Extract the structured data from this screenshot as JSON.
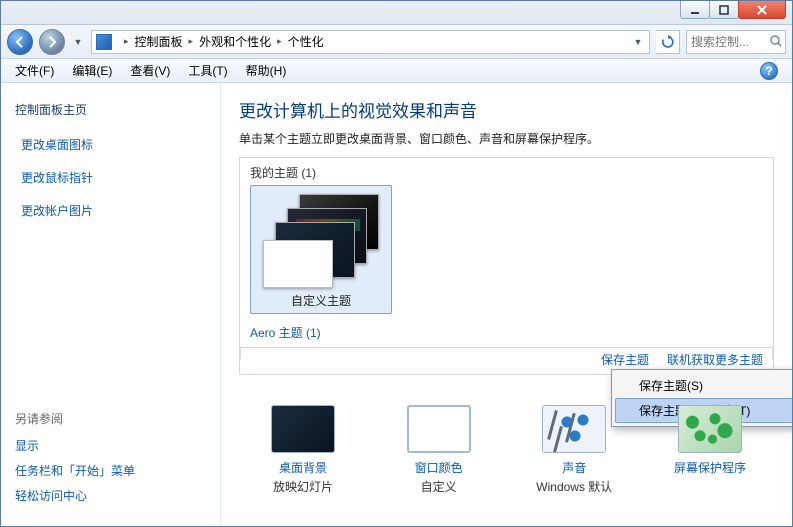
{
  "breadcrumb": {
    "root": "控制面板",
    "mid": "外观和个性化",
    "leaf": "个性化"
  },
  "search": {
    "placeholder": "搜索控制..."
  },
  "menu": {
    "file": "文件(F)",
    "edit": "编辑(E)",
    "view": "查看(V)",
    "tools": "工具(T)",
    "help": "帮助(H)"
  },
  "sidebar": {
    "home": "控制面板主页",
    "links": [
      "更改桌面图标",
      "更改鼠标指针",
      "更改帐户图片"
    ],
    "seealso_head": "另请参阅",
    "seealso": [
      "显示",
      "任务栏和「开始」菜单",
      "轻松访问中心"
    ]
  },
  "page": {
    "title": "更改计算机上的视觉效果和声音",
    "desc": "单击某个主题立即更改桌面背景、窗口颜色、声音和屏幕保护程序。"
  },
  "themes": {
    "mytitle": "我的主题 (1)",
    "custom_label": "自定义主题",
    "save": "保存主题",
    "getmore": "联机获取更多主题",
    "aerotitle": "Aero 主题 (1)"
  },
  "ctx": {
    "save": "保存主题(S)",
    "share": "保存主题用于共享(T)"
  },
  "settings": {
    "bg": {
      "title": "桌面背景",
      "sub": "放映幻灯片"
    },
    "color": {
      "title": "窗口颜色",
      "sub": "自定义"
    },
    "sound": {
      "title": "声音",
      "sub": "Windows 默认"
    },
    "saver": {
      "title": "屏幕保护程序",
      "sub": ""
    }
  }
}
